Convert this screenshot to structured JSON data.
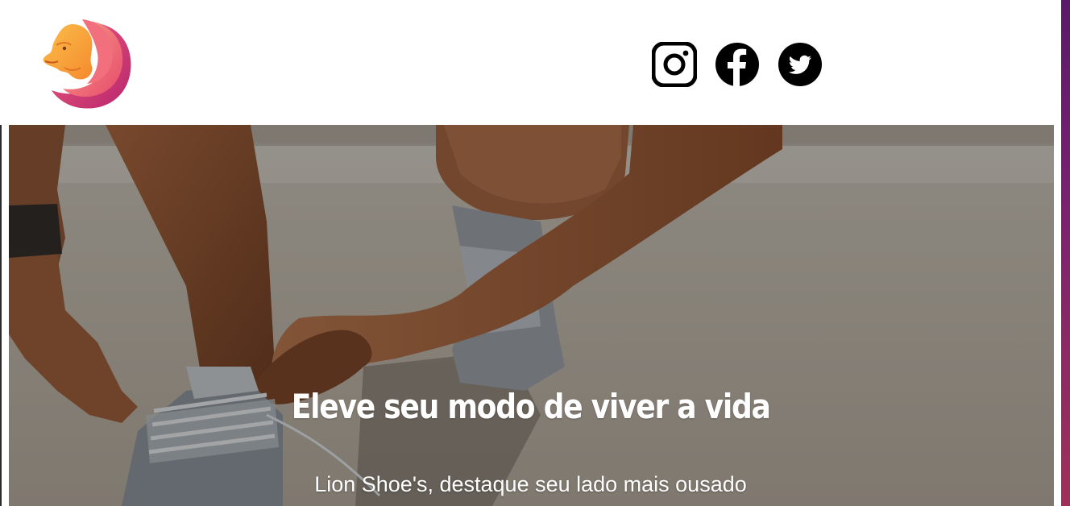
{
  "brand": {
    "logo_icon": "lion-head-logo",
    "colors": {
      "orange": "#f7a23a",
      "pink": "#e8506f",
      "magenta": "#c22a78"
    }
  },
  "social": [
    {
      "name": "Instagram",
      "icon": "instagram-icon"
    },
    {
      "name": "Facebook",
      "icon": "facebook-icon"
    },
    {
      "name": "Twitter",
      "icon": "twitter-icon"
    }
  ],
  "hero": {
    "title": "Eleve seu modo de viver a vida",
    "subtitle": "Lion Shoe's, destaque seu lado mais ousado",
    "image": "runner-tying-shoelaces-photo"
  }
}
